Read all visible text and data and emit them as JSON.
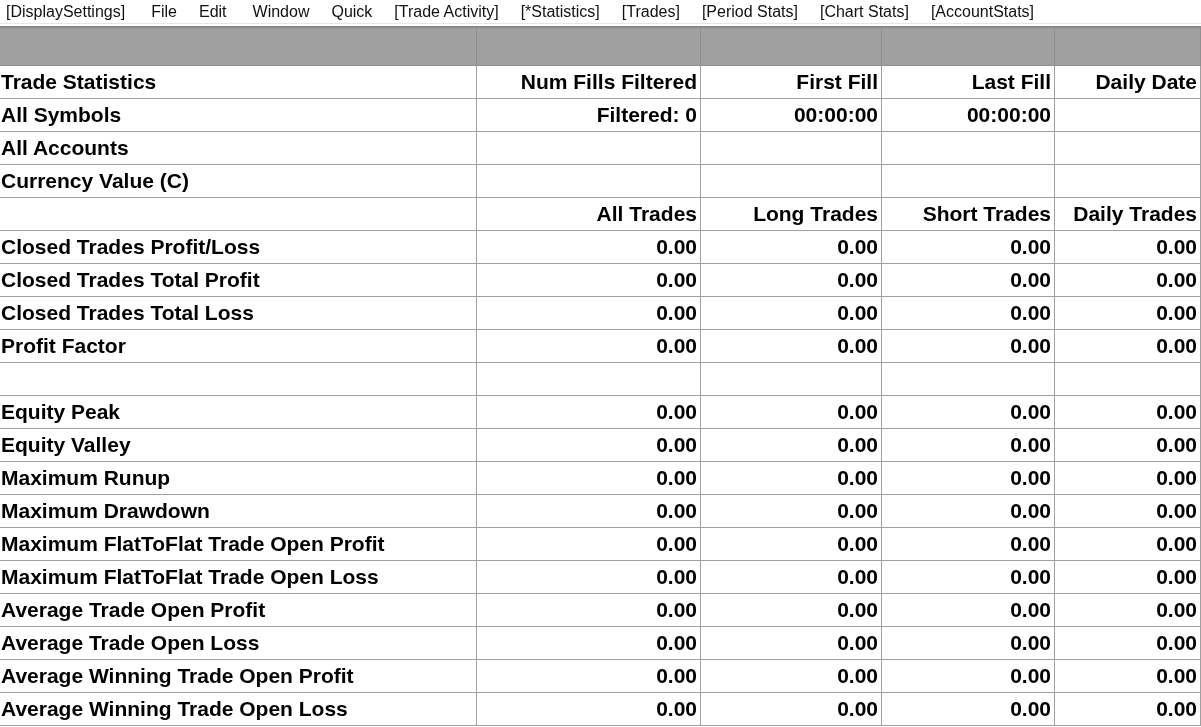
{
  "menu": [
    "[DisplaySettings]",
    "File",
    "Edit",
    "Window",
    "Quick",
    "[Trade Activity]",
    "[*Statistics]",
    "[Trades]",
    "[Period Stats]",
    "[Chart Stats]",
    "[AccountStats]"
  ],
  "table": {
    "rows": [
      {
        "label": "Trade Statistics",
        "cells": [
          "Num Fills Filtered",
          "First Fill",
          "Last Fill",
          "Daily Date"
        ]
      },
      {
        "label": "All Symbols",
        "cells": [
          "Filtered: 0",
          "00:00:00",
          "00:00:00",
          null
        ]
      },
      {
        "label": "All Accounts",
        "cells": [
          null,
          null,
          null,
          null
        ]
      },
      {
        "label": "Currency Value (C)",
        "cells": [
          null,
          null,
          null,
          null
        ]
      },
      {
        "label": null,
        "cells": [
          "All Trades",
          "Long Trades",
          "Short Trades",
          "Daily Trades"
        ]
      },
      {
        "label": "Closed Trades Profit/Loss",
        "cells": [
          "0.00",
          "0.00",
          "0.00",
          "0.00"
        ]
      },
      {
        "label": "Closed Trades Total Profit",
        "cells": [
          "0.00",
          "0.00",
          "0.00",
          "0.00"
        ]
      },
      {
        "label": "Closed Trades Total Loss",
        "cells": [
          "0.00",
          "0.00",
          "0.00",
          "0.00"
        ]
      },
      {
        "label": "Profit Factor",
        "cells": [
          "0.00",
          "0.00",
          "0.00",
          "0.00"
        ]
      },
      {
        "label": null,
        "cells": [
          null,
          null,
          null,
          null
        ]
      },
      {
        "label": "Equity Peak",
        "cells": [
          "0.00",
          "0.00",
          "0.00",
          "0.00"
        ]
      },
      {
        "label": "Equity Valley",
        "cells": [
          "0.00",
          "0.00",
          "0.00",
          "0.00"
        ]
      },
      {
        "label": "Maximum Runup",
        "cells": [
          "0.00",
          "0.00",
          "0.00",
          "0.00"
        ]
      },
      {
        "label": "Maximum Drawdown",
        "cells": [
          "0.00",
          "0.00",
          "0.00",
          "0.00"
        ]
      },
      {
        "label": "Maximum FlatToFlat Trade Open Profit",
        "cells": [
          "0.00",
          "0.00",
          "0.00",
          "0.00"
        ]
      },
      {
        "label": "Maximum FlatToFlat Trade Open Loss",
        "cells": [
          "0.00",
          "0.00",
          "0.00",
          "0.00"
        ]
      },
      {
        "label": "Average Trade Open Profit",
        "cells": [
          "0.00",
          "0.00",
          "0.00",
          "0.00"
        ]
      },
      {
        "label": "Average Trade Open Loss",
        "cells": [
          "0.00",
          "0.00",
          "0.00",
          "0.00"
        ]
      },
      {
        "label": "Average Winning Trade Open Profit",
        "cells": [
          "0.00",
          "0.00",
          "0.00",
          "0.00"
        ]
      },
      {
        "label": "Average Winning Trade Open Loss",
        "cells": [
          "0.00",
          "0.00",
          "0.00",
          "0.00"
        ]
      }
    ]
  }
}
